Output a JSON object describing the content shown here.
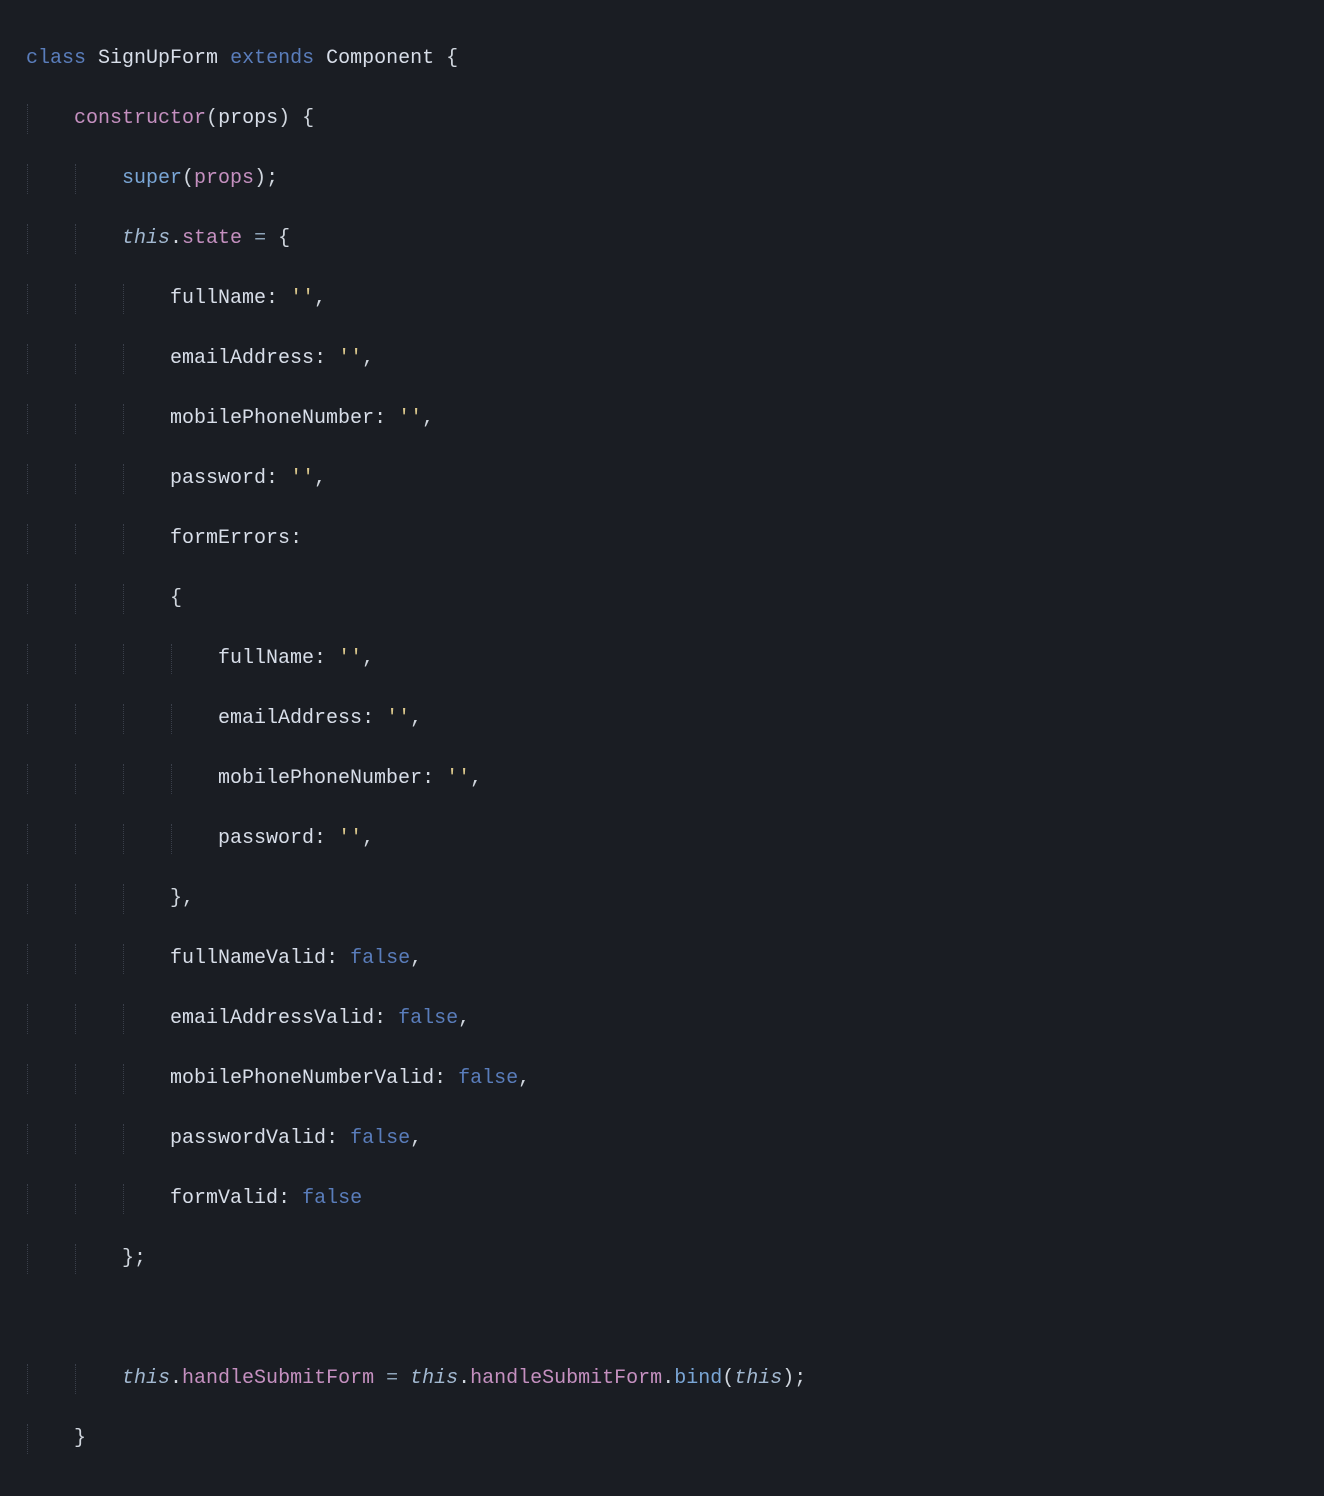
{
  "code": {
    "kw_class": "class",
    "class_name": "SignUpForm",
    "kw_extends": "extends",
    "base_class": "Component",
    "brace_open": "{",
    "constructor": "constructor",
    "paren_open": "(",
    "param_props": "props",
    "paren_close": ")",
    "super": "super",
    "semi": ";",
    "this": "this",
    "dot": ".",
    "state": "state",
    "eq": "=",
    "keys": {
      "fullName": "fullName",
      "emailAddress": "emailAddress",
      "mobilePhoneNumber": "mobilePhoneNumber",
      "password": "password",
      "formErrors": "formErrors",
      "fullNameValid": "fullNameValid",
      "emailAddressValid": "emailAddressValid",
      "mobilePhoneNumberValid": "mobilePhoneNumberValid",
      "passwordValid": "passwordValid",
      "formValid": "formValid"
    },
    "colon": ":",
    "empty_str": "''",
    "comma": ",",
    "false": "false",
    "brace_close": "}",
    "handleSubmitForm": "handleSubmitForm",
    "bind": "bind"
  }
}
